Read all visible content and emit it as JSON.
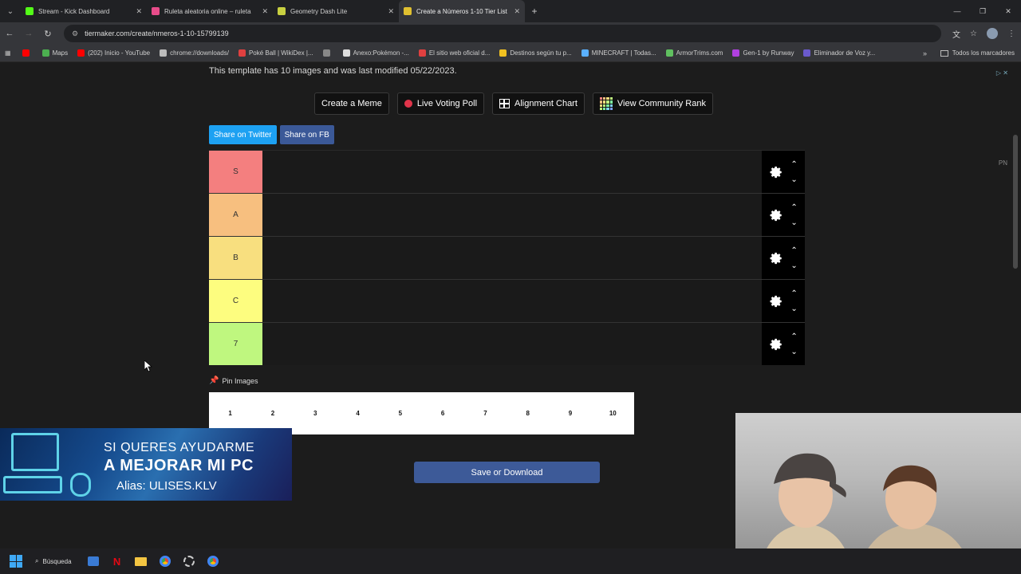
{
  "browser": {
    "tabs": [
      {
        "title": "Stream - Kick Dashboard",
        "color": "#53fc18",
        "active": false
      },
      {
        "title": "Ruleta aleatoria online – ruleta",
        "color": "#e84c8a",
        "active": false
      },
      {
        "title": "Geometry Dash Lite",
        "color": "#c8d040",
        "active": false
      },
      {
        "title": "Create a Números 1-10 Tier List",
        "color": "#e0c030",
        "active": true
      }
    ],
    "url": "tiermaker.com/create/nmeros-1-10-15799139",
    "bookmarks": [
      {
        "label": "",
        "color": "#ff0000"
      },
      {
        "label": "Maps",
        "color": "#4caf50"
      },
      {
        "label": "(202) Inicio - YouTube",
        "color": "#ff0000"
      },
      {
        "label": "chrome://downloads/",
        "color": "#bbbbbb"
      },
      {
        "label": "Poké Ball | WikiDex |...",
        "color": "#e04040"
      },
      {
        "label": "",
        "color": "#888888"
      },
      {
        "label": "Anexo:Pokémon -...",
        "color": "#dddddd"
      },
      {
        "label": "El sitio web oficial d...",
        "color": "#e04040"
      },
      {
        "label": "Destinos según tu p...",
        "color": "#f0c020"
      },
      {
        "label": "MINECRAFT | Todas...",
        "color": "#5ab0ff"
      },
      {
        "label": "ArmorTrims.com",
        "color": "#60c060"
      },
      {
        "label": "Gen-1 by Runway",
        "color": "#b040e0"
      },
      {
        "label": "Eliminador de Voz y...",
        "color": "#6a5acd"
      }
    ],
    "all_bookmarks": "Todos los marcadores"
  },
  "page": {
    "template_info": "This template has 10 images and was last modified 05/22/2023.",
    "actions": {
      "create_meme": "Create a Meme",
      "live_voting": "Live Voting Poll",
      "alignment": "Alignment Chart",
      "community_rank": "View Community Rank"
    },
    "share": {
      "twitter": "Share on Twitter",
      "fb": "Share on FB"
    },
    "tiers": [
      {
        "label": "S",
        "color": "#f47f7f"
      },
      {
        "label": "A",
        "color": "#f7bf7f"
      },
      {
        "label": "B",
        "color": "#f8df7f"
      },
      {
        "label": "C",
        "color": "#fdfd7f"
      },
      {
        "label": "7",
        "color": "#bff77f"
      }
    ],
    "pin_label": "Pin Images",
    "pool": [
      "1",
      "2",
      "3",
      "4",
      "5",
      "6",
      "7",
      "8",
      "9",
      "10"
    ],
    "save_label": "Save or Download",
    "side_text": "PN"
  },
  "banner": {
    "line1": "SI QUERES AYUDARME",
    "line2": "A MEJORAR MI PC",
    "line3": "Alias: ULISES.KLV"
  },
  "taskbar": {
    "search": "Búsqueda"
  }
}
